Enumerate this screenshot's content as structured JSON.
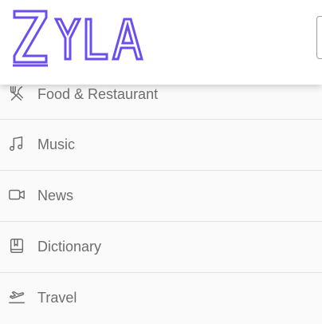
{
  "header": {
    "logo_text": "ZYLA",
    "brand_color": "#6c4ef0"
  },
  "menu": {
    "items": [
      {
        "label": "Food & Restaurant",
        "icon": "fork-knife-icon"
      },
      {
        "label": "Music",
        "icon": "music-note-icon"
      },
      {
        "label": "News",
        "icon": "video-camera-icon"
      },
      {
        "label": "Dictionary",
        "icon": "book-icon"
      },
      {
        "label": "Travel",
        "icon": "airplane-takeoff-icon"
      }
    ]
  }
}
